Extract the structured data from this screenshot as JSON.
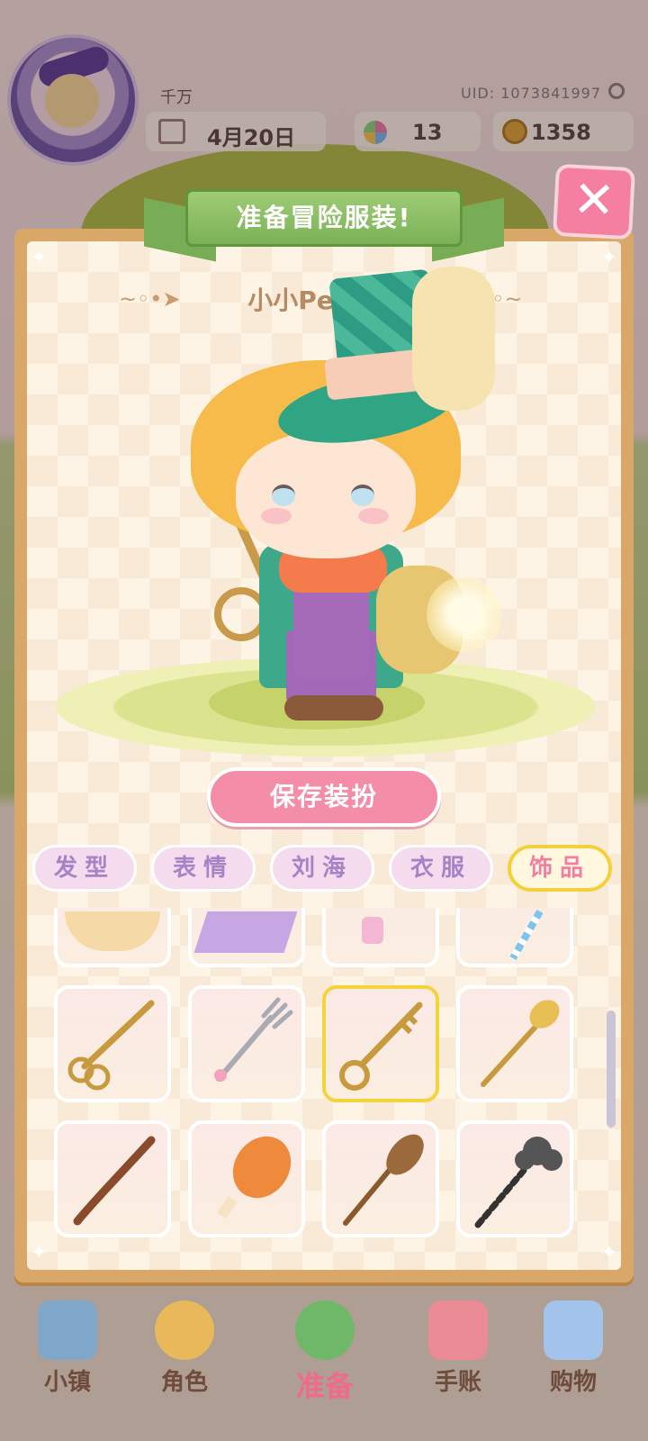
{
  "profile": {
    "nickname": "千万",
    "uid": "UID: 1073841997",
    "date": "4月20日",
    "flowers": "13",
    "coins": "1358"
  },
  "modal": {
    "title": "准备冒险服装!",
    "character_name": "小小Peacoo",
    "save_label": "保存装扮",
    "close_icon": "close-icon"
  },
  "tabs": [
    {
      "label": "发型",
      "active": false
    },
    {
      "label": "表情",
      "active": false
    },
    {
      "label": "刘海",
      "active": false
    },
    {
      "label": "衣服",
      "active": false
    },
    {
      "label": "饰品",
      "active": true
    }
  ],
  "items": [
    {
      "icon": "bread-icon",
      "selected": false
    },
    {
      "icon": "purple-cloth-icon",
      "selected": false
    },
    {
      "icon": "perfume-bottle-icon",
      "selected": false
    },
    {
      "icon": "straw-icon",
      "selected": false
    },
    {
      "icon": "golden-scissors-icon",
      "selected": false
    },
    {
      "icon": "silver-fork-icon",
      "selected": false
    },
    {
      "icon": "golden-key-icon",
      "selected": true
    },
    {
      "icon": "golden-spoon-icon",
      "selected": false
    },
    {
      "icon": "wooden-wand-icon",
      "selected": false
    },
    {
      "icon": "chicken-leg-icon",
      "selected": false
    },
    {
      "icon": "broom-icon",
      "selected": false
    },
    {
      "icon": "cloud-wand-icon",
      "selected": false
    }
  ],
  "nav": [
    {
      "label": "小镇",
      "icon": "town-map-icon"
    },
    {
      "label": "角色",
      "icon": "character-icon"
    },
    {
      "label": "准备",
      "icon": "prepare-icon"
    },
    {
      "label": "手账",
      "icon": "journal-icon"
    },
    {
      "label": "购物",
      "icon": "shopping-bag-icon"
    }
  ],
  "colors": {
    "accent_pink": "#f48da8",
    "ribbon_green": "#7bb257",
    "panel_frame": "#d9a869",
    "active_tab_border": "#f3d13c"
  }
}
